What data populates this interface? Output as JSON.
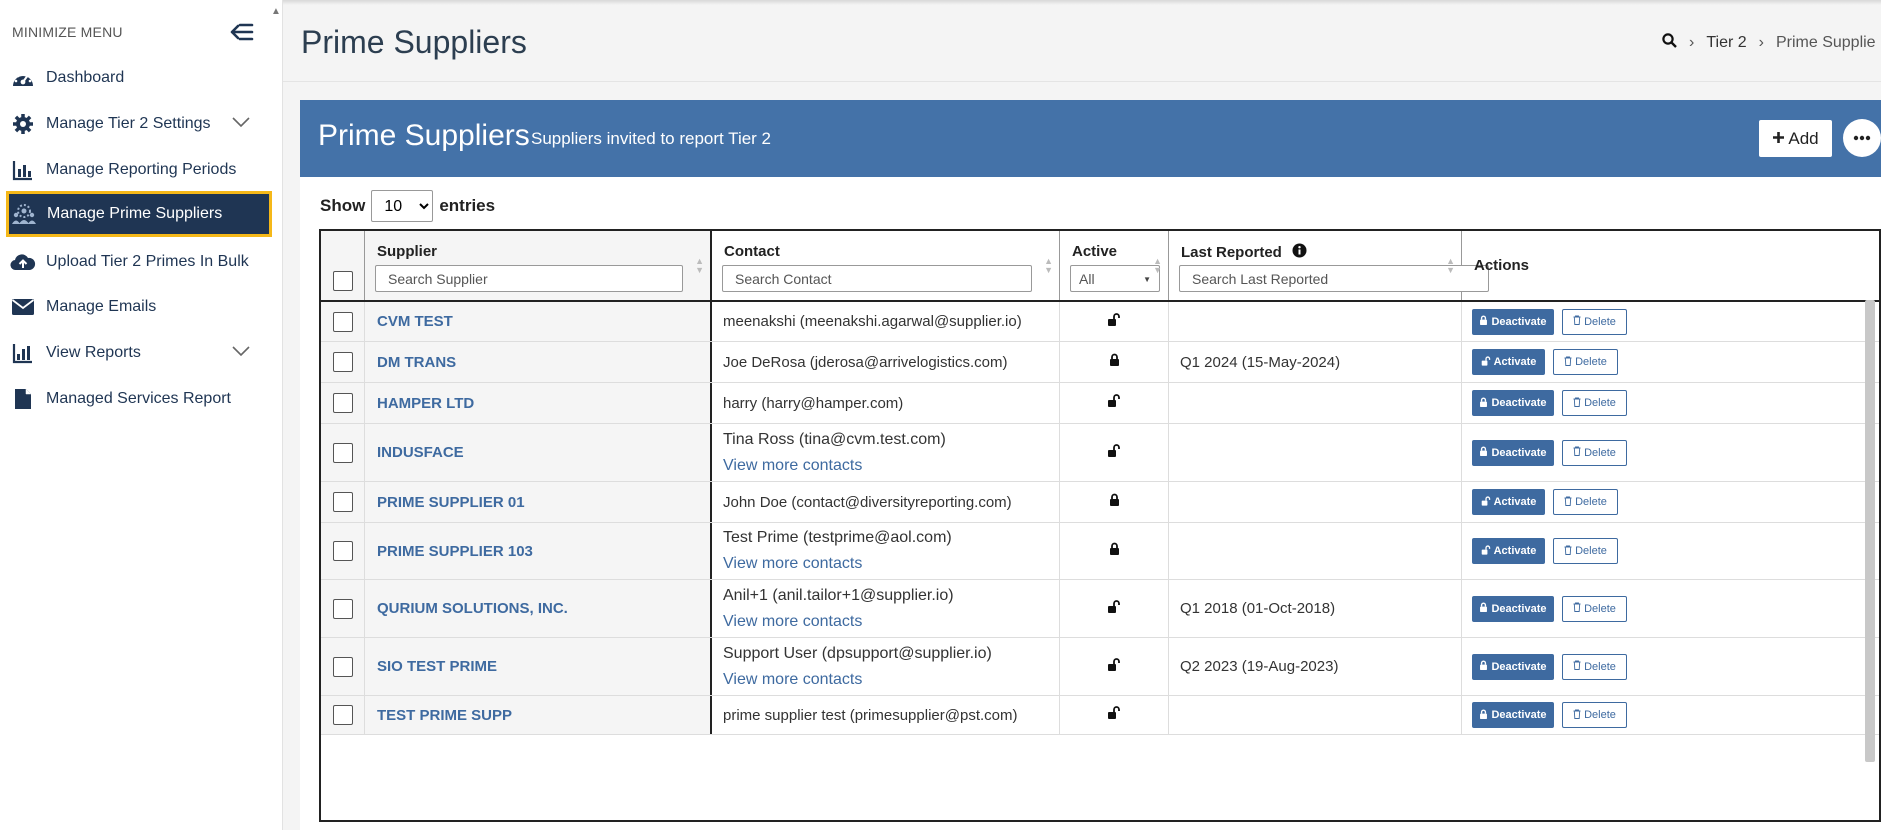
{
  "sidebar": {
    "minimize_label": "MINIMIZE MENU",
    "items": [
      {
        "label": "Dashboard",
        "icon": "speedometer-icon"
      },
      {
        "label": "Manage Tier 2 Settings",
        "icon": "gear-icon",
        "expandable": true
      },
      {
        "label": "Manage Reporting Periods",
        "icon": "calendar-chart-icon"
      },
      {
        "label": "Manage Prime Suppliers",
        "icon": "users-gear-icon",
        "active": true
      },
      {
        "label": "Upload Tier 2 Primes In Bulk",
        "icon": "cloud-upload-icon"
      },
      {
        "label": "Manage Emails",
        "icon": "envelope-icon"
      },
      {
        "label": "View Reports",
        "icon": "bar-chart-icon",
        "expandable": true
      },
      {
        "label": "Managed Services Report",
        "icon": "document-icon"
      }
    ]
  },
  "header": {
    "title": "Prime Suppliers",
    "breadcrumb": [
      "Tier 2",
      "Prime Supplie"
    ]
  },
  "panel": {
    "title": "Prime Suppliers",
    "subtitle": "Suppliers invited to report Tier 2",
    "add_label": "Add"
  },
  "entries": {
    "show_label": "Show",
    "value": "10",
    "entries_label": "entries"
  },
  "table": {
    "columns": {
      "supplier": "Supplier",
      "contact": "Contact",
      "active": "Active",
      "last_reported": "Last Reported",
      "actions": "Actions"
    },
    "placeholders": {
      "supplier": "Search Supplier",
      "contact": "Search Contact",
      "active": "All",
      "last_reported": "Search Last Reported"
    },
    "rows": [
      {
        "supplier": "CVM TEST",
        "contact": "meenakshi (meenakshi.agarwal@supplier.io)",
        "more": "",
        "active": false,
        "last_reported": "",
        "state_label": "Deactivate",
        "delete_label": "Delete"
      },
      {
        "supplier": "DM TRANS",
        "contact": "Joe DeRosa (jderosa@arrivelogistics.com)",
        "more": "",
        "active": true,
        "last_reported": "Q1 2024 (15-May-2024)",
        "state_label": "Activate",
        "delete_label": "Delete"
      },
      {
        "supplier": "HAMPER LTD",
        "contact": "harry (harry@hamper.com)",
        "more": "",
        "active": false,
        "last_reported": "",
        "state_label": "Deactivate",
        "delete_label": "Delete"
      },
      {
        "supplier": "INDUSFACE",
        "contact": "Tina Ross (tina@cvm.test.com)",
        "more": "View more contacts",
        "active": false,
        "last_reported": "",
        "state_label": "Deactivate",
        "delete_label": "Delete"
      },
      {
        "supplier": "PRIME SUPPLIER 01",
        "contact": "John Doe (contact@diversityreporting.com)",
        "more": "",
        "active": true,
        "last_reported": "",
        "state_label": "Activate",
        "delete_label": "Delete"
      },
      {
        "supplier": "PRIME SUPPLIER 103",
        "contact": "Test Prime (testprime@aol.com)",
        "more": "View more contacts",
        "active": true,
        "last_reported": "",
        "state_label": "Activate",
        "delete_label": "Delete"
      },
      {
        "supplier": "QURIUM SOLUTIONS, INC.",
        "contact": "Anil+1 (anil.tailor+1@supplier.io)",
        "more": "View more contacts",
        "active": false,
        "last_reported": "Q1 2018 (01-Oct-2018)",
        "state_label": "Deactivate",
        "delete_label": "Delete"
      },
      {
        "supplier": "SIO TEST PRIME",
        "contact": "Support User (dpsupport@supplier.io)",
        "more": "View more contacts",
        "active": false,
        "last_reported": "Q2 2023 (19-Aug-2023)",
        "state_label": "Deactivate",
        "delete_label": "Delete"
      },
      {
        "supplier": "TEST PRIME SUPP",
        "contact": "prime supplier test (primesupplier@pst.com)",
        "more": "",
        "active": false,
        "last_reported": "",
        "state_label": "Deactivate",
        "delete_label": "Delete"
      }
    ]
  },
  "colors": {
    "brand": "#4472a8",
    "nav_active": "#1f3553",
    "highlight": "#f5b819",
    "link": "#3e6aa0"
  }
}
